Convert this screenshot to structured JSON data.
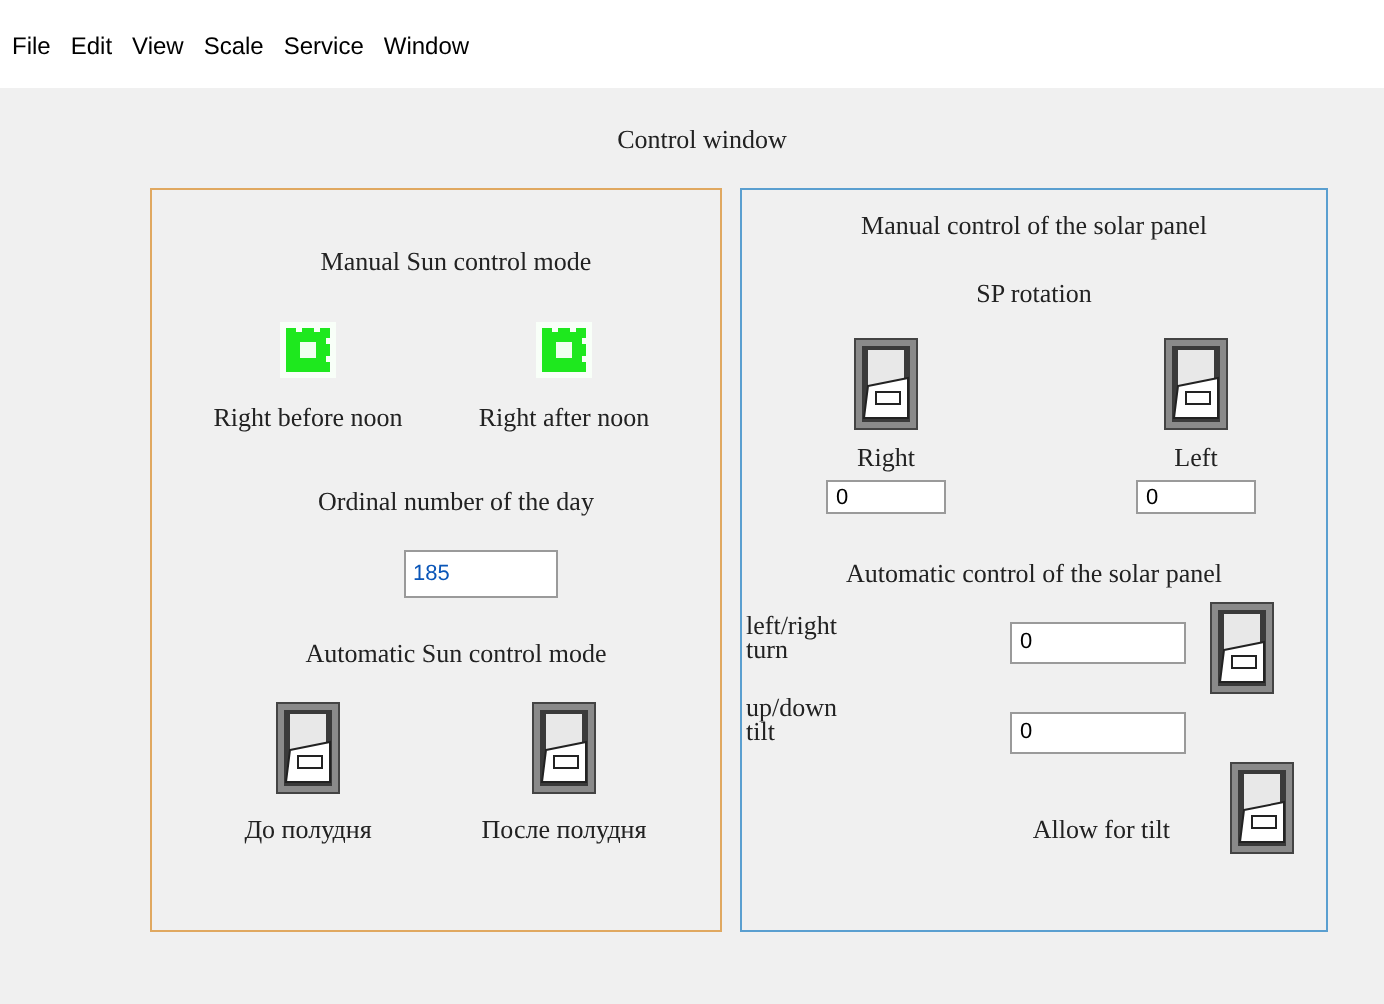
{
  "menu": [
    "File",
    "Edit",
    "View",
    "Scale",
    "Service",
    "Window"
  ],
  "window": {
    "title": "Control window"
  },
  "sun_panel": {
    "manual_title": "Manual Sun control mode",
    "indicators": [
      {
        "label": "Right before noon",
        "lit": true
      },
      {
        "label": "Right after noon",
        "lit": true
      }
    ],
    "day_label": "Ordinal number of the day",
    "day_value": "185",
    "auto_title": "Automatic Sun control mode",
    "switches": [
      {
        "label": "До полудня",
        "on": false
      },
      {
        "label": "После полудня",
        "on": false
      }
    ]
  },
  "solar_panel": {
    "manual_title": "Manual control of the solar panel",
    "rotation_title": "SP rotation",
    "rotation": [
      {
        "label": "Right",
        "on": false,
        "value": "0"
      },
      {
        "label": "Left",
        "on": false,
        "value": "0"
      }
    ],
    "auto_title": "Automatic control of the solar panel",
    "turn": {
      "label": "left/right turn",
      "value": "0",
      "on": false
    },
    "tilt": {
      "label": "up/down tilt",
      "value": "0"
    },
    "allow_tilt": {
      "label": "Allow for tilt",
      "on": false
    }
  }
}
